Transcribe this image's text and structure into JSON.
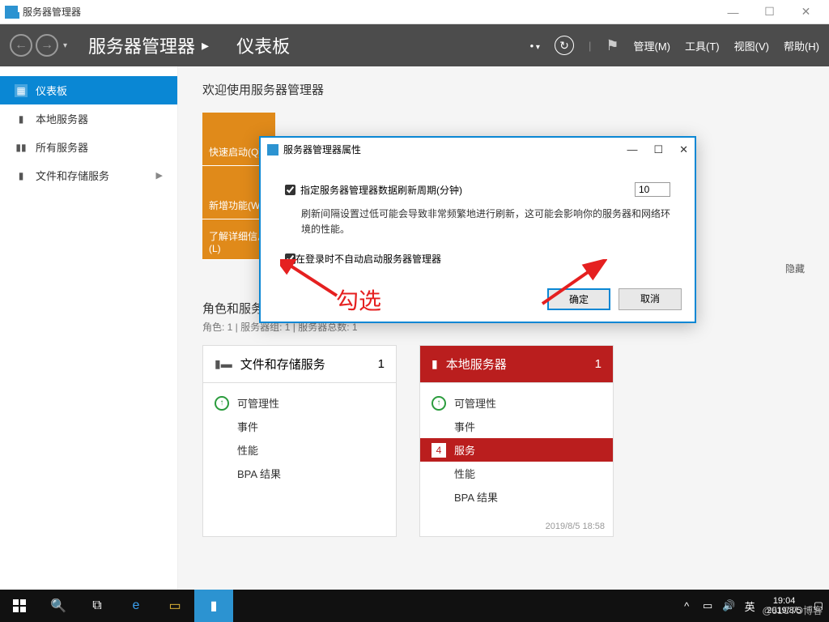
{
  "window": {
    "title": "服务器管理器",
    "min": "—",
    "max": "☐",
    "close": "✕"
  },
  "header": {
    "crumb1": "服务器管理器",
    "crumb2": "仪表板",
    "dropdown": "",
    "menu": {
      "manage": "管理(M)",
      "tools": "工具(T)",
      "view": "视图(V)",
      "help": "帮助(H)"
    }
  },
  "sidebar": {
    "items": [
      {
        "label": "仪表板"
      },
      {
        "label": "本地服务器"
      },
      {
        "label": "所有服务器"
      },
      {
        "label": "文件和存储服务"
      }
    ]
  },
  "main": {
    "welcome": "欢迎使用服务器管理器",
    "tabs": {
      "quick": "快速启动(Q)",
      "whatsnew": "新增功能(W)",
      "learn": "了解详细信息(L)"
    },
    "hide": "隐藏",
    "roles_title": "角色和服务器组",
    "roles_sub": "角色: 1 | 服务器组: 1 | 服务器总数: 1"
  },
  "cards": [
    {
      "title": "文件和存储服务",
      "count": "1",
      "rows": [
        "可管理性",
        "事件",
        "性能",
        "BPA 结果"
      ]
    },
    {
      "title": "本地服务器",
      "count": "1",
      "rows": [
        "可管理性",
        "事件",
        "服务",
        "性能",
        "BPA 结果"
      ],
      "badge": "4",
      "footer": "2019/8/5 18:58"
    }
  ],
  "dialog": {
    "title": "服务器管理器属性",
    "row1": "指定服务器管理器数据刷新周期(分钟)",
    "value": "10",
    "note": "刷新间隔设置过低可能会导致非常频繁地进行刷新，这可能会影响你的服务器和网络环境的性能。",
    "row2": "在登录时不自动启动服务器管理器",
    "ok": "确定",
    "cancel": "取消",
    "min": "—",
    "max": "☐",
    "close": "✕"
  },
  "annotation": {
    "text": "勾选"
  },
  "taskbar": {
    "ime": "英",
    "time": "19:04",
    "date": "2019/8/5"
  },
  "watermark": "@51CTO博客"
}
